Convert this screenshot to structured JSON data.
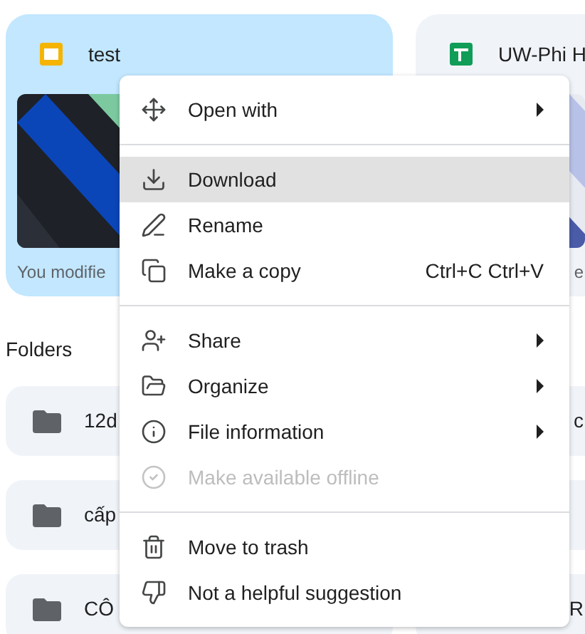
{
  "files": [
    {
      "name": "test",
      "kind": "slides",
      "footer": "You modifie",
      "selected": true
    },
    {
      "name": "UW-Phi H",
      "kind": "sheets",
      "footer": "e",
      "selected": false
    }
  ],
  "folders_heading": "Folders",
  "folders": [
    {
      "left": "12d",
      "right": "c"
    },
    {
      "left": "cấp"
    },
    {
      "left": "CÔ",
      "right": "R"
    }
  ],
  "menu": [
    [
      {
        "label": "Open with",
        "submenu": true,
        "disabled": false,
        "selected": false
      }
    ],
    [
      {
        "label": "Download",
        "submenu": false,
        "disabled": false,
        "selected": true
      },
      {
        "label": "Rename",
        "submenu": false,
        "disabled": false,
        "selected": false
      },
      {
        "label": "Make a copy",
        "shortcut": "Ctrl+C Ctrl+V",
        "submenu": false,
        "disabled": false,
        "selected": false
      }
    ],
    [
      {
        "label": "Share",
        "submenu": true,
        "disabled": false,
        "selected": false
      },
      {
        "label": "Organize",
        "submenu": true,
        "disabled": false,
        "selected": false
      },
      {
        "label": "File information",
        "submenu": true,
        "disabled": false,
        "selected": false
      },
      {
        "label": "Make available offline",
        "submenu": false,
        "disabled": true,
        "selected": false
      }
    ],
    [
      {
        "label": "Move to trash",
        "submenu": false,
        "disabled": false,
        "selected": false
      },
      {
        "label": "Not a helpful suggestion",
        "submenu": false,
        "disabled": false,
        "selected": false
      }
    ]
  ]
}
